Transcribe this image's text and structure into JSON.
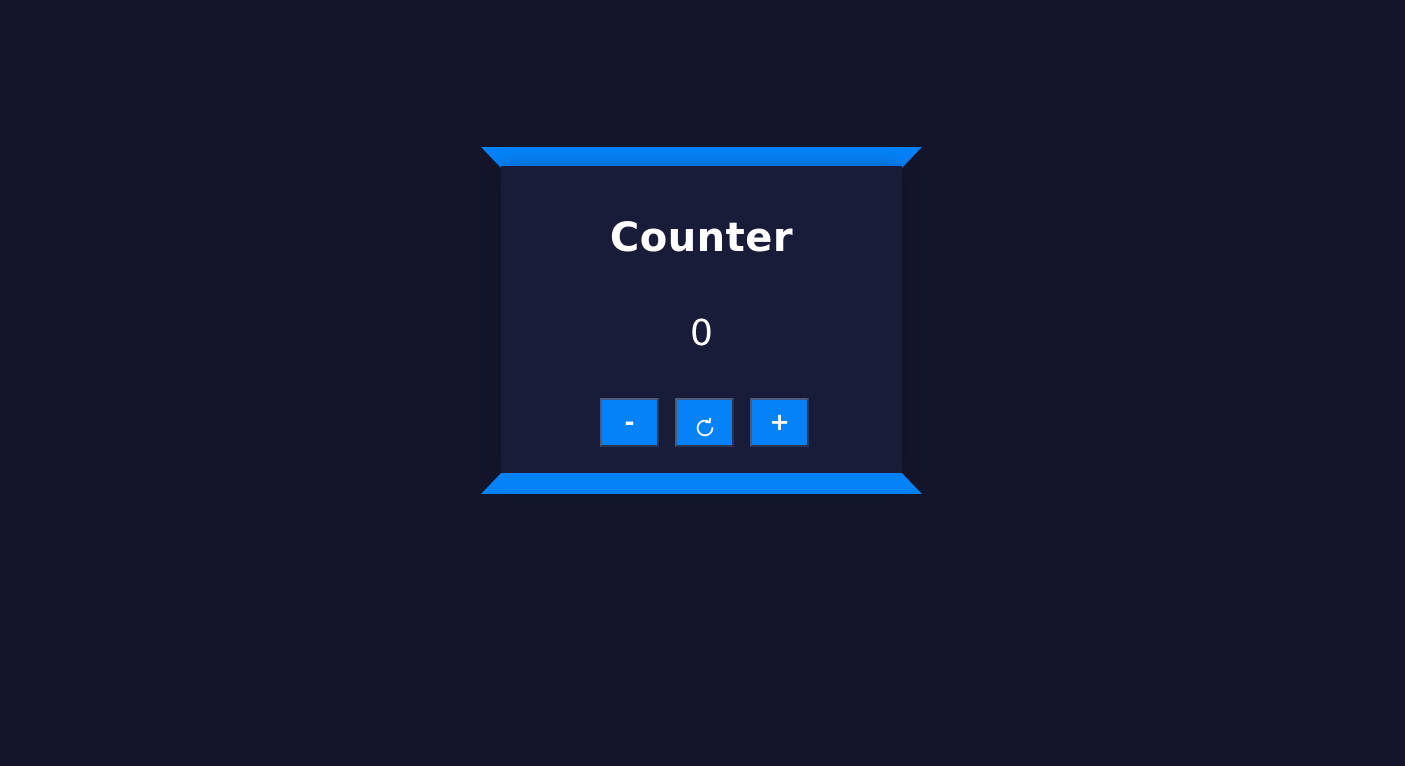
{
  "counter": {
    "title": "Counter",
    "value": "0"
  },
  "controls": {
    "decrement_label": "-",
    "reset_icon": "reset-icon",
    "increment_label": "+"
  },
  "colors": {
    "background": "#13162a",
    "card": "#181c38",
    "accent": "#0682f8",
    "text": "#ffffff"
  }
}
